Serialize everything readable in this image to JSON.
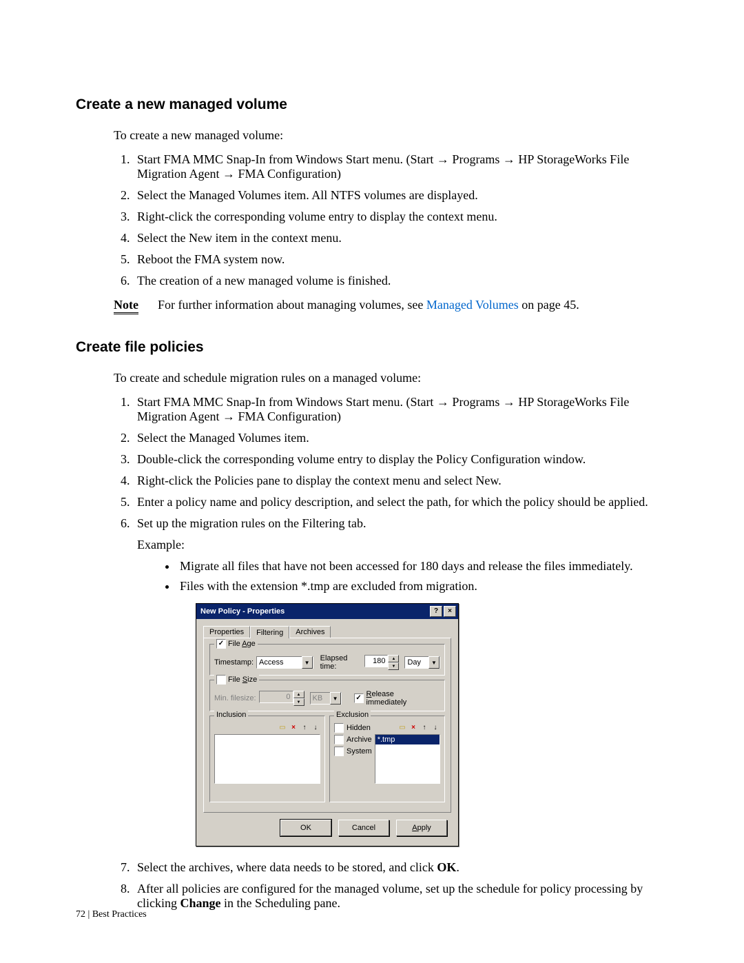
{
  "section1": {
    "heading": "Create a new managed volume",
    "intro": "To create a new managed volume:",
    "steps": [
      "Start FMA MMC Snap-In from Windows Start menu. (Start → Programs → HP StorageWorks File Migration Agent → FMA Configuration)",
      "Select the Managed Volumes item. All NTFS volumes are displayed.",
      "Right-click the corresponding volume entry to display the context menu.",
      "Select the New item in the context menu.",
      "Reboot the FMA system now.",
      "The creation of a new managed volume is finished."
    ],
    "note_label": "Note",
    "note_text_pre": "For further information about managing volumes, see ",
    "note_link": "Managed Volumes",
    "note_text_post": " on page 45."
  },
  "section2": {
    "heading": "Create file policies",
    "intro": "To create and schedule migration rules on a managed volume:",
    "steps_1_6": [
      "Start FMA MMC Snap-In from Windows Start menu. (Start → Programs → HP StorageWorks File Migration Agent → FMA Configuration)",
      "Select the Managed Volumes item.",
      "Double-click the corresponding volume entry to display the Policy Configuration window.",
      "Right-click the Policies pane to display the context menu and select New.",
      "Enter a policy name and policy description, and select the path, for which the policy should be applied.",
      "Set up the migration rules on the Filtering tab."
    ],
    "example_label": "Example:",
    "bullets": [
      "Migrate all files that have not been accessed for 180 days and release the files immediately.",
      "Files with the extension *.tmp are excluded from migration."
    ],
    "step7_pre": "Select the archives, where data needs to be stored, and click ",
    "step7_bold": "OK",
    "step7_post": ".",
    "step8_pre": "After all policies are configured for the managed volume, set up the schedule for policy processing by clicking ",
    "step8_bold": "Change",
    "step8_post": " in the Scheduling pane."
  },
  "dialog": {
    "title": "New Policy - Properties",
    "tabs": {
      "properties": "Properties",
      "filtering": "Filtering",
      "archives": "Archives"
    },
    "file_age": {
      "legend": "File Age",
      "checked": true,
      "timestamp_label": "Timestamp:",
      "timestamp_value": "Access",
      "elapsed_label": "Elapsed time:",
      "elapsed_value": "180",
      "unit": "Day"
    },
    "file_size": {
      "legend": "File Size",
      "checked": false,
      "min_label": "Min. filesize:",
      "min_value": "0",
      "unit": "KB",
      "release_label": "Release immediately",
      "release_checked": true
    },
    "inclusion": {
      "legend": "Inclusion"
    },
    "exclusion": {
      "legend": "Exclusion",
      "hidden": "Hidden",
      "archive": "Archive",
      "system": "System",
      "item": "*.tmp"
    },
    "buttons": {
      "ok": "OK",
      "cancel": "Cancel",
      "apply": "Apply"
    }
  },
  "footer": {
    "page": "72",
    "sep": " | ",
    "chapter": "Best Practices"
  }
}
